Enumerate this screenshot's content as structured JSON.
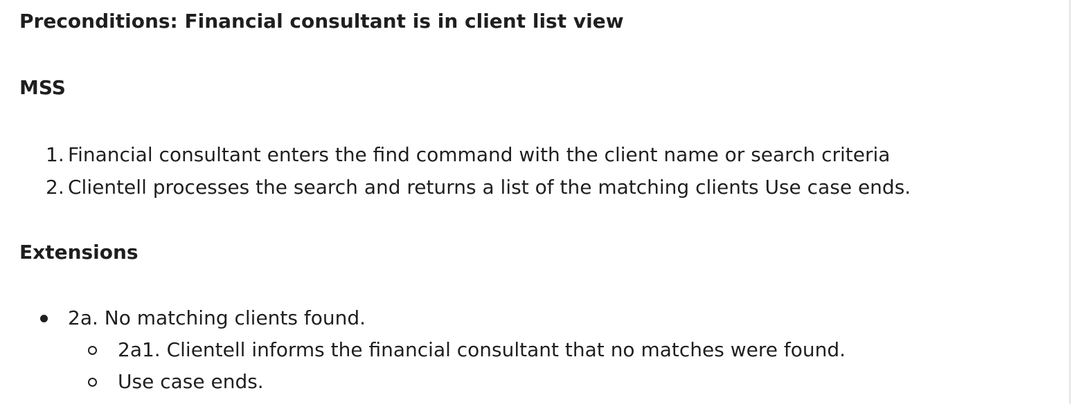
{
  "preconditions": {
    "heading": "Preconditions: Financial consultant is in client list view"
  },
  "mss": {
    "heading": "MSS",
    "steps": [
      {
        "number": "1.",
        "text": "Financial consultant enters the find command with the client name or search criteria"
      },
      {
        "number": "2.",
        "text": "Clientell processes the search and returns a list of the matching clients Use case ends."
      }
    ]
  },
  "extensions": {
    "heading": "Extensions",
    "items": [
      {
        "text": "2a. No matching clients found.",
        "sub_items": [
          "2a1. Clientell informs the financial consultant that no matches were found.",
          "Use case ends."
        ]
      }
    ]
  }
}
